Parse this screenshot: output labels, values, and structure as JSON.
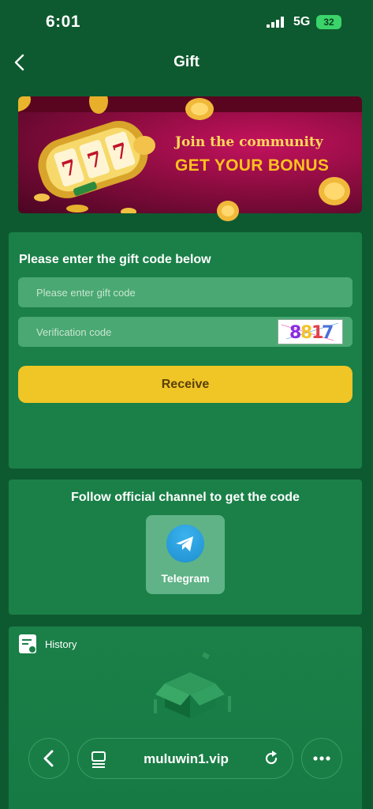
{
  "status_bar": {
    "time": "6:01",
    "network": "5G",
    "battery": "32"
  },
  "header": {
    "title": "Gift",
    "back_icon": "chevron-left-icon"
  },
  "banner": {
    "line1": "Join the community",
    "line2": "GET YOUR BONUS"
  },
  "gift_form": {
    "label": "Please enter the gift code below",
    "gift_code": {
      "placeholder": "Please enter gift code",
      "value": ""
    },
    "verification": {
      "placeholder": "Verification code",
      "value": ""
    },
    "captcha_text": "8817",
    "receive_label": "Receive"
  },
  "follow": {
    "label": "Follow official channel to get the code",
    "telegram_label": "Telegram"
  },
  "history": {
    "label": "History"
  },
  "browser": {
    "url": "muluwin1.vip"
  },
  "colors": {
    "background": "#0e5a30",
    "card": "#1a8048",
    "accent": "#f0c526",
    "telegram": "#2aa3e3"
  }
}
